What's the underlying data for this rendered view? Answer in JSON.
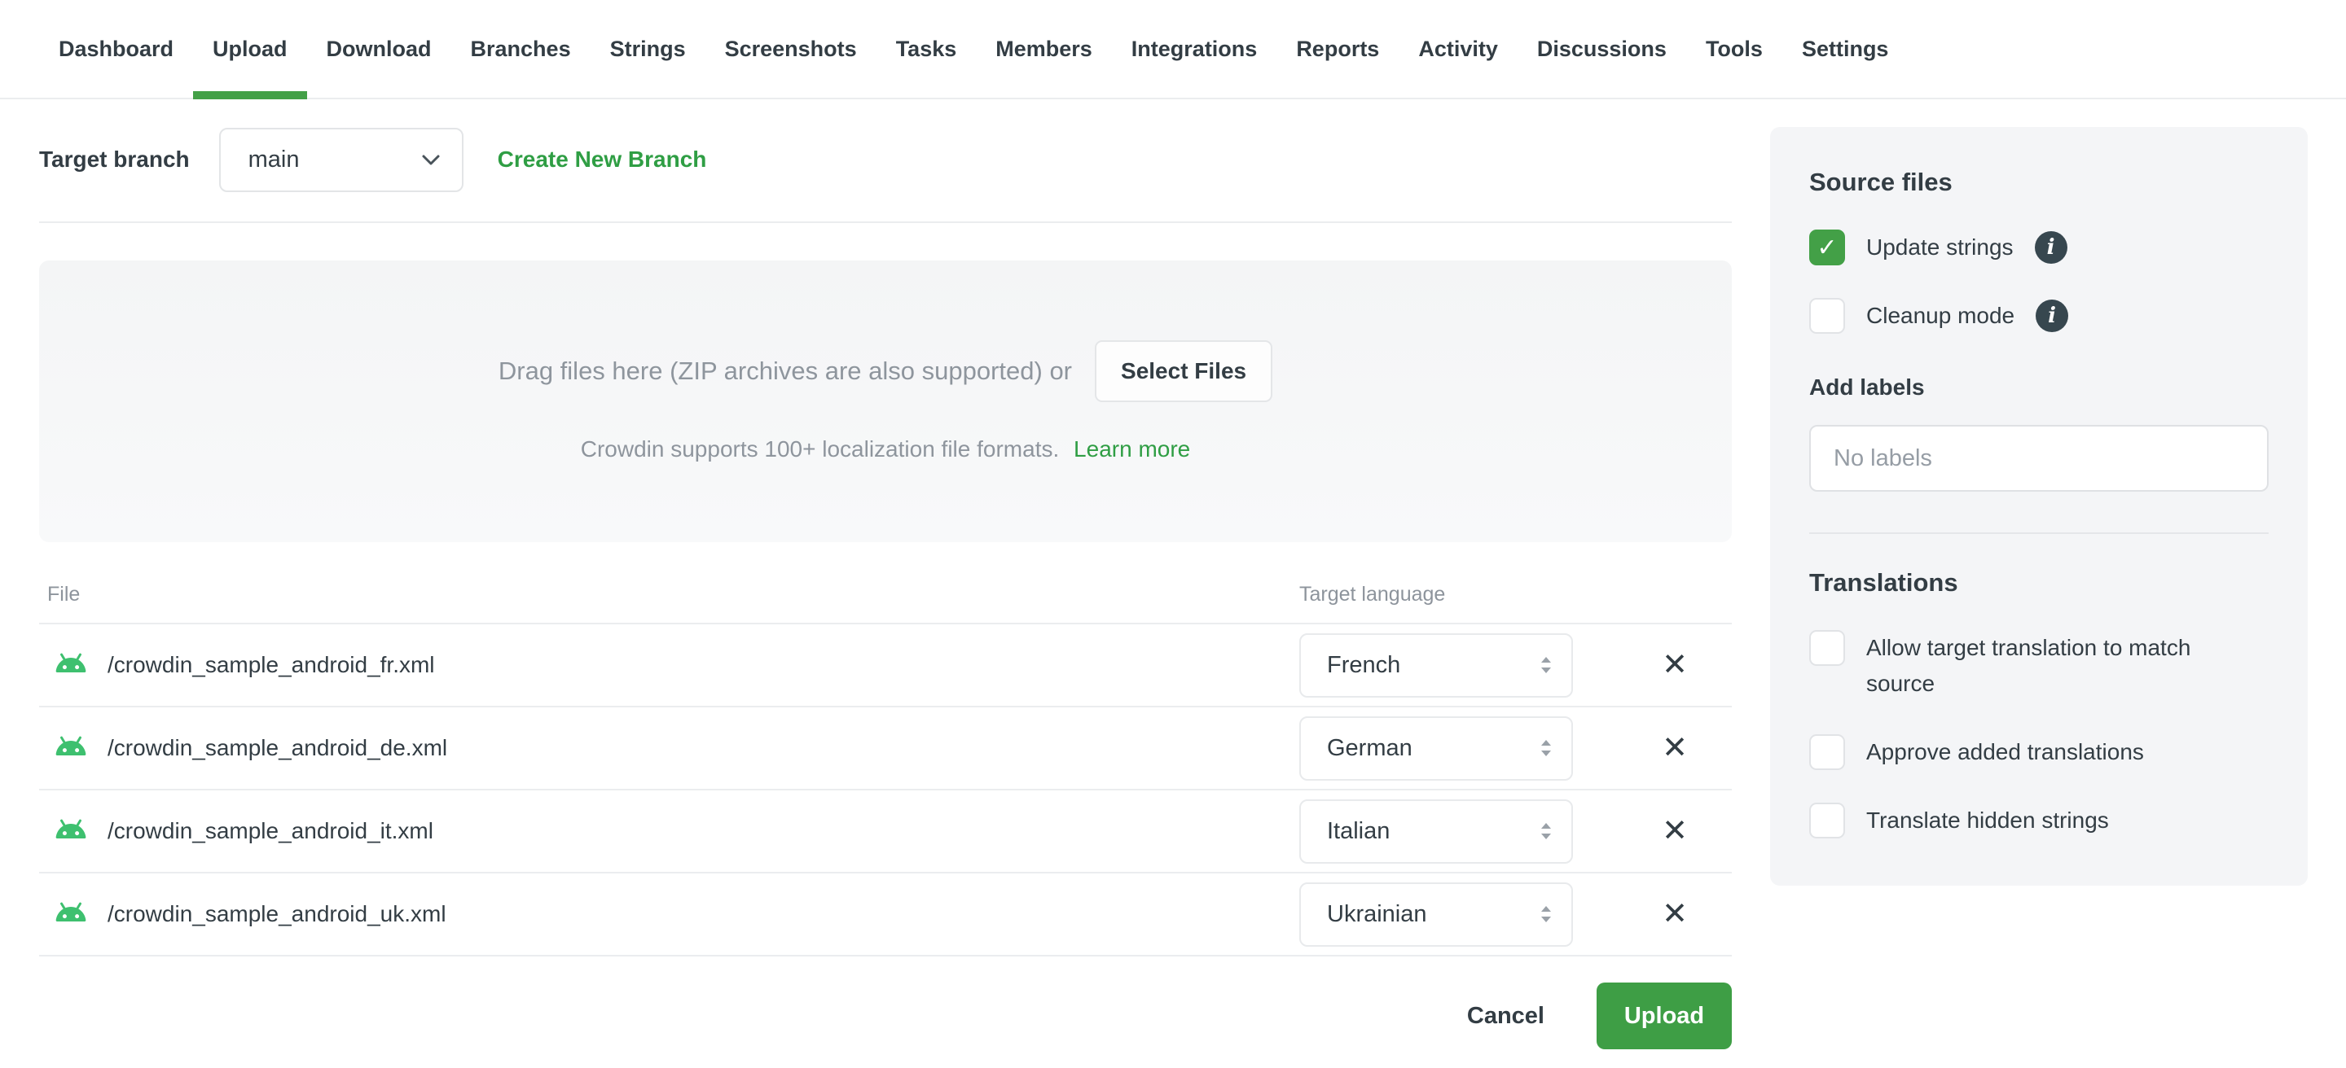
{
  "nav": {
    "items": [
      {
        "label": "Dashboard",
        "active": false
      },
      {
        "label": "Upload",
        "active": true
      },
      {
        "label": "Download",
        "active": false
      },
      {
        "label": "Branches",
        "active": false
      },
      {
        "label": "Strings",
        "active": false
      },
      {
        "label": "Screenshots",
        "active": false
      },
      {
        "label": "Tasks",
        "active": false
      },
      {
        "label": "Members",
        "active": false
      },
      {
        "label": "Integrations",
        "active": false
      },
      {
        "label": "Reports",
        "active": false
      },
      {
        "label": "Activity",
        "active": false
      },
      {
        "label": "Discussions",
        "active": false
      },
      {
        "label": "Tools",
        "active": false
      },
      {
        "label": "Settings",
        "active": false
      }
    ]
  },
  "branch": {
    "label": "Target branch",
    "selected": "main",
    "create_link": "Create New Branch"
  },
  "dropzone": {
    "drag_text": "Drag files here (ZIP archives are also supported) or",
    "select_files_label": "Select Files",
    "formats_text": "Crowdin supports 100+ localization file formats.",
    "learn_more_label": "Learn more"
  },
  "files_table": {
    "columns": {
      "file": "File",
      "target_language": "Target language"
    },
    "rows": [
      {
        "file": "/crowdin_sample_android_fr.xml",
        "language": "French"
      },
      {
        "file": "/crowdin_sample_android_de.xml",
        "language": "German"
      },
      {
        "file": "/crowdin_sample_android_it.xml",
        "language": "Italian"
      },
      {
        "file": "/crowdin_sample_android_uk.xml",
        "language": "Ukrainian"
      }
    ],
    "remove_icon": "✕"
  },
  "actions": {
    "cancel_label": "Cancel",
    "upload_label": "Upload"
  },
  "sidebar": {
    "source_files": {
      "title": "Source files",
      "options": [
        {
          "label": "Update strings",
          "checked": true,
          "check_glyph": "✓"
        },
        {
          "label": "Cleanup mode",
          "checked": false,
          "check_glyph": "✓"
        }
      ],
      "info_glyph": "i"
    },
    "labels": {
      "title": "Add labels",
      "placeholder": "No labels",
      "value": ""
    },
    "translations": {
      "title": "Translations",
      "options": [
        {
          "label": "Allow target translation to match source",
          "checked": false,
          "check_glyph": "✓"
        },
        {
          "label": "Approve added translations",
          "checked": false,
          "check_glyph": "✓"
        },
        {
          "label": "Translate hidden strings",
          "checked": false,
          "check_glyph": "✓"
        }
      ]
    }
  },
  "colors": {
    "accent_green": "#43a047",
    "button_green": "#3e9e45",
    "link_green": "#2f9e44",
    "android_green": "#3ec06f",
    "text_dark": "#333d44",
    "text_gray": "#8e959d",
    "border_gray": "#ebedef",
    "info_circle": "#37474f",
    "panel_bg": "#f4f5f7"
  }
}
